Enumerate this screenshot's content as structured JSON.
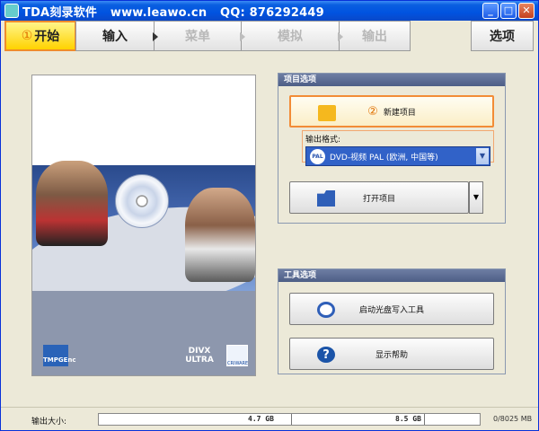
{
  "titlebar": {
    "app": "TDA刻录软件",
    "url": "www.leawo.cn",
    "qq": "QQ: 876292449",
    "minimize": "_",
    "maximize": "□",
    "close": "✕"
  },
  "tabs": [
    {
      "num": "①",
      "label": "开始",
      "state": "active"
    },
    {
      "label": "输入",
      "state": "normal"
    },
    {
      "label": "菜单",
      "state": "disabled"
    },
    {
      "label": "模拟",
      "state": "disabled"
    },
    {
      "label": "输出",
      "state": "disabled"
    },
    {
      "label": "选项",
      "state": "normal"
    }
  ],
  "preview": {
    "logo_left": "TMPGEnc",
    "logo_divx": "DIVX ULTRA",
    "logo_cri": "CRIWARE"
  },
  "project_group": {
    "title": "项目选项",
    "new_project_num": "②",
    "new_project_label": "新建项目",
    "format_label": "输出格式:",
    "format_value": "DVD-视频 PAL (欧洲, 中国等)",
    "format_badge": "PAL",
    "open_project_label": "打开项目"
  },
  "tools_group": {
    "title": "工具选项",
    "burn_label": "启动光盘写入工具",
    "help_label": "显示帮助"
  },
  "status": {
    "size_label": "输出大小:",
    "mark_1": "4.7 GB",
    "mark_2": "8.5 GB",
    "size_value": "0/8025 MB"
  },
  "colors": {
    "title_bar": "#0053e0",
    "active_tab": "#ffd200",
    "highlight_border": "#f28c36",
    "select_bg": "#3162c8"
  }
}
